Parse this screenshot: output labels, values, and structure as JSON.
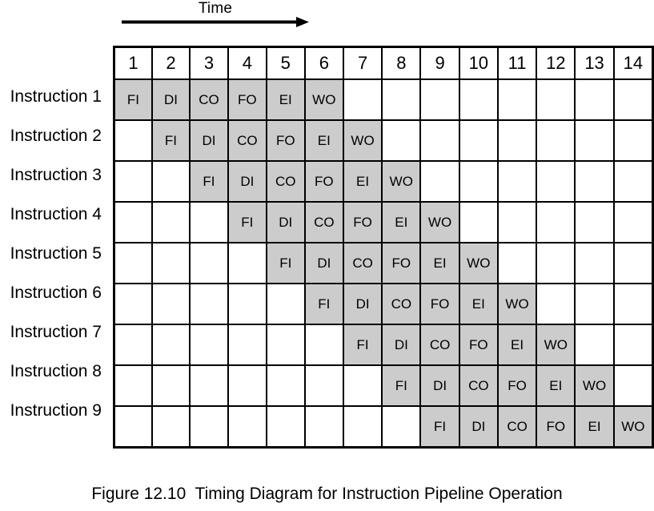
{
  "figure": {
    "caption": "Figure 12.10  Timing Diagram for Instruction Pipeline Operation",
    "time_axis_label": "Time",
    "arrow_icon": "right-arrow-icon"
  },
  "colors": {
    "stage_fill": "#cccccc",
    "empty_fill": "#ffffff",
    "line": "#000000",
    "text": "#000000"
  },
  "grid": {
    "column_headers": [
      "1",
      "2",
      "3",
      "4",
      "5",
      "6",
      "7",
      "8",
      "9",
      "10",
      "11",
      "12",
      "13",
      "14"
    ],
    "row_labels": [
      "Instruction 1",
      "Instruction 2",
      "Instruction 3",
      "Instruction 4",
      "Instruction 5",
      "Instruction 6",
      "Instruction 7",
      "Instruction 8",
      "Instruction 9"
    ],
    "stages": [
      "FI",
      "DI",
      "CO",
      "FO",
      "EI",
      "WO"
    ],
    "rows": [
      [
        "FI",
        "DI",
        "CO",
        "FO",
        "EI",
        "WO",
        "",
        "",
        "",
        "",
        "",
        "",
        "",
        ""
      ],
      [
        "",
        "FI",
        "DI",
        "CO",
        "FO",
        "EI",
        "WO",
        "",
        "",
        "",
        "",
        "",
        "",
        ""
      ],
      [
        "",
        "",
        "FI",
        "DI",
        "CO",
        "FO",
        "EI",
        "WO",
        "",
        "",
        "",
        "",
        "",
        ""
      ],
      [
        "",
        "",
        "",
        "FI",
        "DI",
        "CO",
        "FO",
        "EI",
        "WO",
        "",
        "",
        "",
        "",
        ""
      ],
      [
        "",
        "",
        "",
        "",
        "FI",
        "DI",
        "CO",
        "FO",
        "EI",
        "WO",
        "",
        "",
        "",
        ""
      ],
      [
        "",
        "",
        "",
        "",
        "",
        "FI",
        "DI",
        "CO",
        "FO",
        "EI",
        "WO",
        "",
        "",
        ""
      ],
      [
        "",
        "",
        "",
        "",
        "",
        "",
        "FI",
        "DI",
        "CO",
        "FO",
        "EI",
        "WO",
        "",
        ""
      ],
      [
        "",
        "",
        "",
        "",
        "",
        "",
        "",
        "FI",
        "DI",
        "CO",
        "FO",
        "EI",
        "WO",
        ""
      ],
      [
        "",
        "",
        "",
        "",
        "",
        "",
        "",
        "",
        "FI",
        "DI",
        "CO",
        "FO",
        "EI",
        "WO"
      ]
    ]
  },
  "chart_data": {
    "type": "table",
    "title": "Figure 12.10  Timing Diagram for Instruction Pipeline Operation",
    "xlabel": "Time",
    "ylabel": "",
    "categories": [
      "1",
      "2",
      "3",
      "4",
      "5",
      "6",
      "7",
      "8",
      "9",
      "10",
      "11",
      "12",
      "13",
      "14"
    ],
    "series": [
      {
        "name": "Instruction 1",
        "values": [
          "FI",
          "DI",
          "CO",
          "FO",
          "EI",
          "WO",
          "",
          "",
          "",
          "",
          "",
          "",
          "",
          ""
        ]
      },
      {
        "name": "Instruction 2",
        "values": [
          "",
          "FI",
          "DI",
          "CO",
          "FO",
          "EI",
          "WO",
          "",
          "",
          "",
          "",
          "",
          "",
          ""
        ]
      },
      {
        "name": "Instruction 3",
        "values": [
          "",
          "",
          "FI",
          "DI",
          "CO",
          "FO",
          "EI",
          "WO",
          "",
          "",
          "",
          "",
          "",
          ""
        ]
      },
      {
        "name": "Instruction 4",
        "values": [
          "",
          "",
          "",
          "FI",
          "DI",
          "CO",
          "FO",
          "EI",
          "WO",
          "",
          "",
          "",
          "",
          ""
        ]
      },
      {
        "name": "Instruction 5",
        "values": [
          "",
          "",
          "",
          "",
          "FI",
          "DI",
          "CO",
          "FO",
          "EI",
          "WO",
          "",
          "",
          "",
          ""
        ]
      },
      {
        "name": "Instruction 6",
        "values": [
          "",
          "",
          "",
          "",
          "",
          "FI",
          "DI",
          "CO",
          "FO",
          "EI",
          "WO",
          "",
          "",
          ""
        ]
      },
      {
        "name": "Instruction 7",
        "values": [
          "",
          "",
          "",
          "",
          "",
          "",
          "FI",
          "DI",
          "CO",
          "FO",
          "EI",
          "WO",
          "",
          ""
        ]
      },
      {
        "name": "Instruction 8",
        "values": [
          "",
          "",
          "",
          "",
          "",
          "",
          "",
          "FI",
          "DI",
          "CO",
          "FO",
          "EI",
          "WO",
          ""
        ]
      },
      {
        "name": "Instruction 9",
        "values": [
          "",
          "",
          "",
          "",
          "",
          "",
          "",
          "",
          "FI",
          "DI",
          "CO",
          "FO",
          "EI",
          "WO"
        ]
      }
    ],
    "grid": true,
    "legend": "none"
  }
}
